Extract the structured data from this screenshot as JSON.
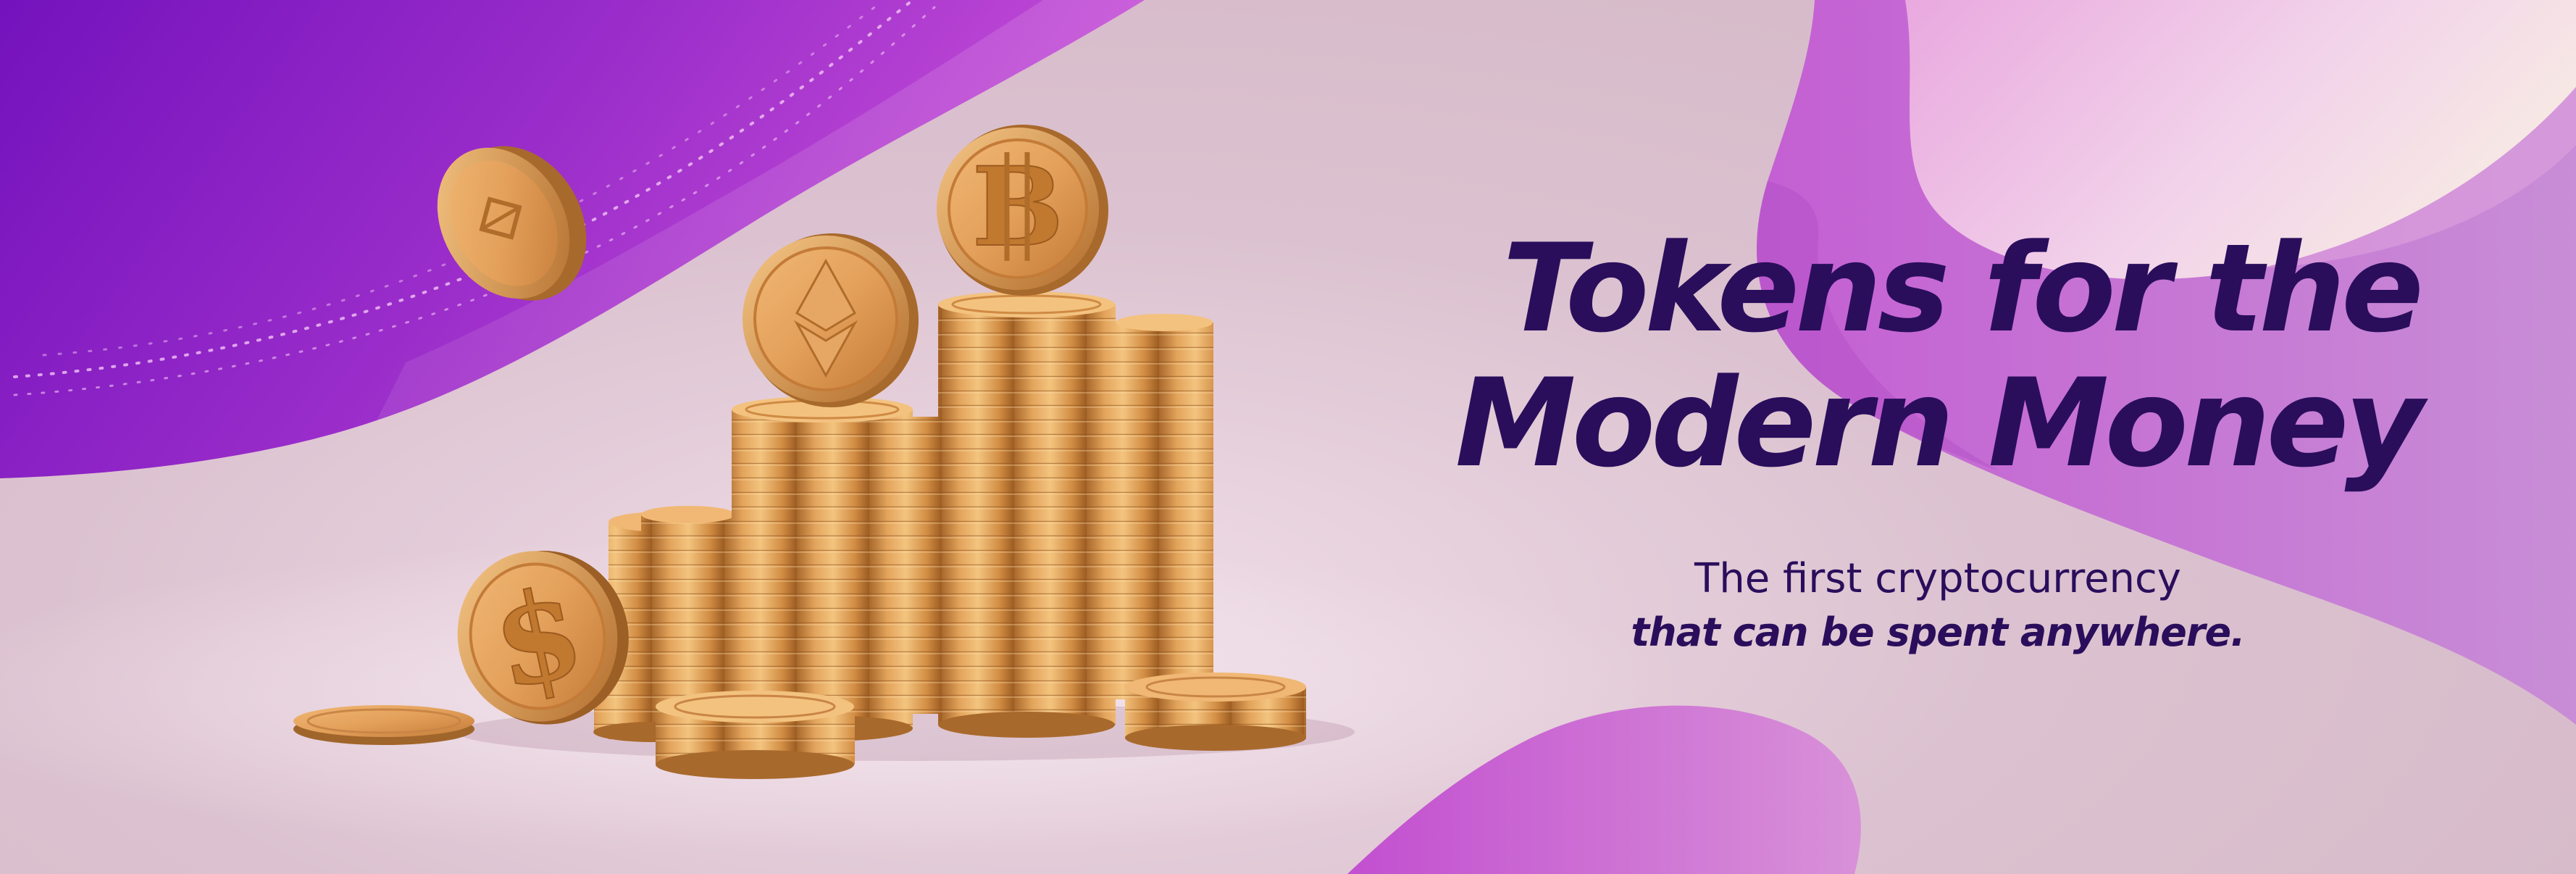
{
  "headline": {
    "line1": "Tokens for the",
    "line2": "Modern Money"
  },
  "subtitle": {
    "line1": "The first cryptocurrency",
    "line2": "that can be spent anywhere."
  },
  "coins": [
    {
      "name": "bitcoin-coin",
      "icon": "bitcoin-icon",
      "glyph": "B"
    },
    {
      "name": "ethereum-coin",
      "icon": "ethereum-icon"
    },
    {
      "name": "dollar-coin",
      "icon": "dollar-icon",
      "glyph": "$"
    },
    {
      "name": "floating-coin",
      "icon": "token-icon"
    }
  ],
  "colors": {
    "headline": "#2a0e5c",
    "purple_wave": "#7b17c0",
    "magenta_wave": "#c565d6",
    "background": "#d9bfcd",
    "coin_gold": "#d99a4e"
  }
}
